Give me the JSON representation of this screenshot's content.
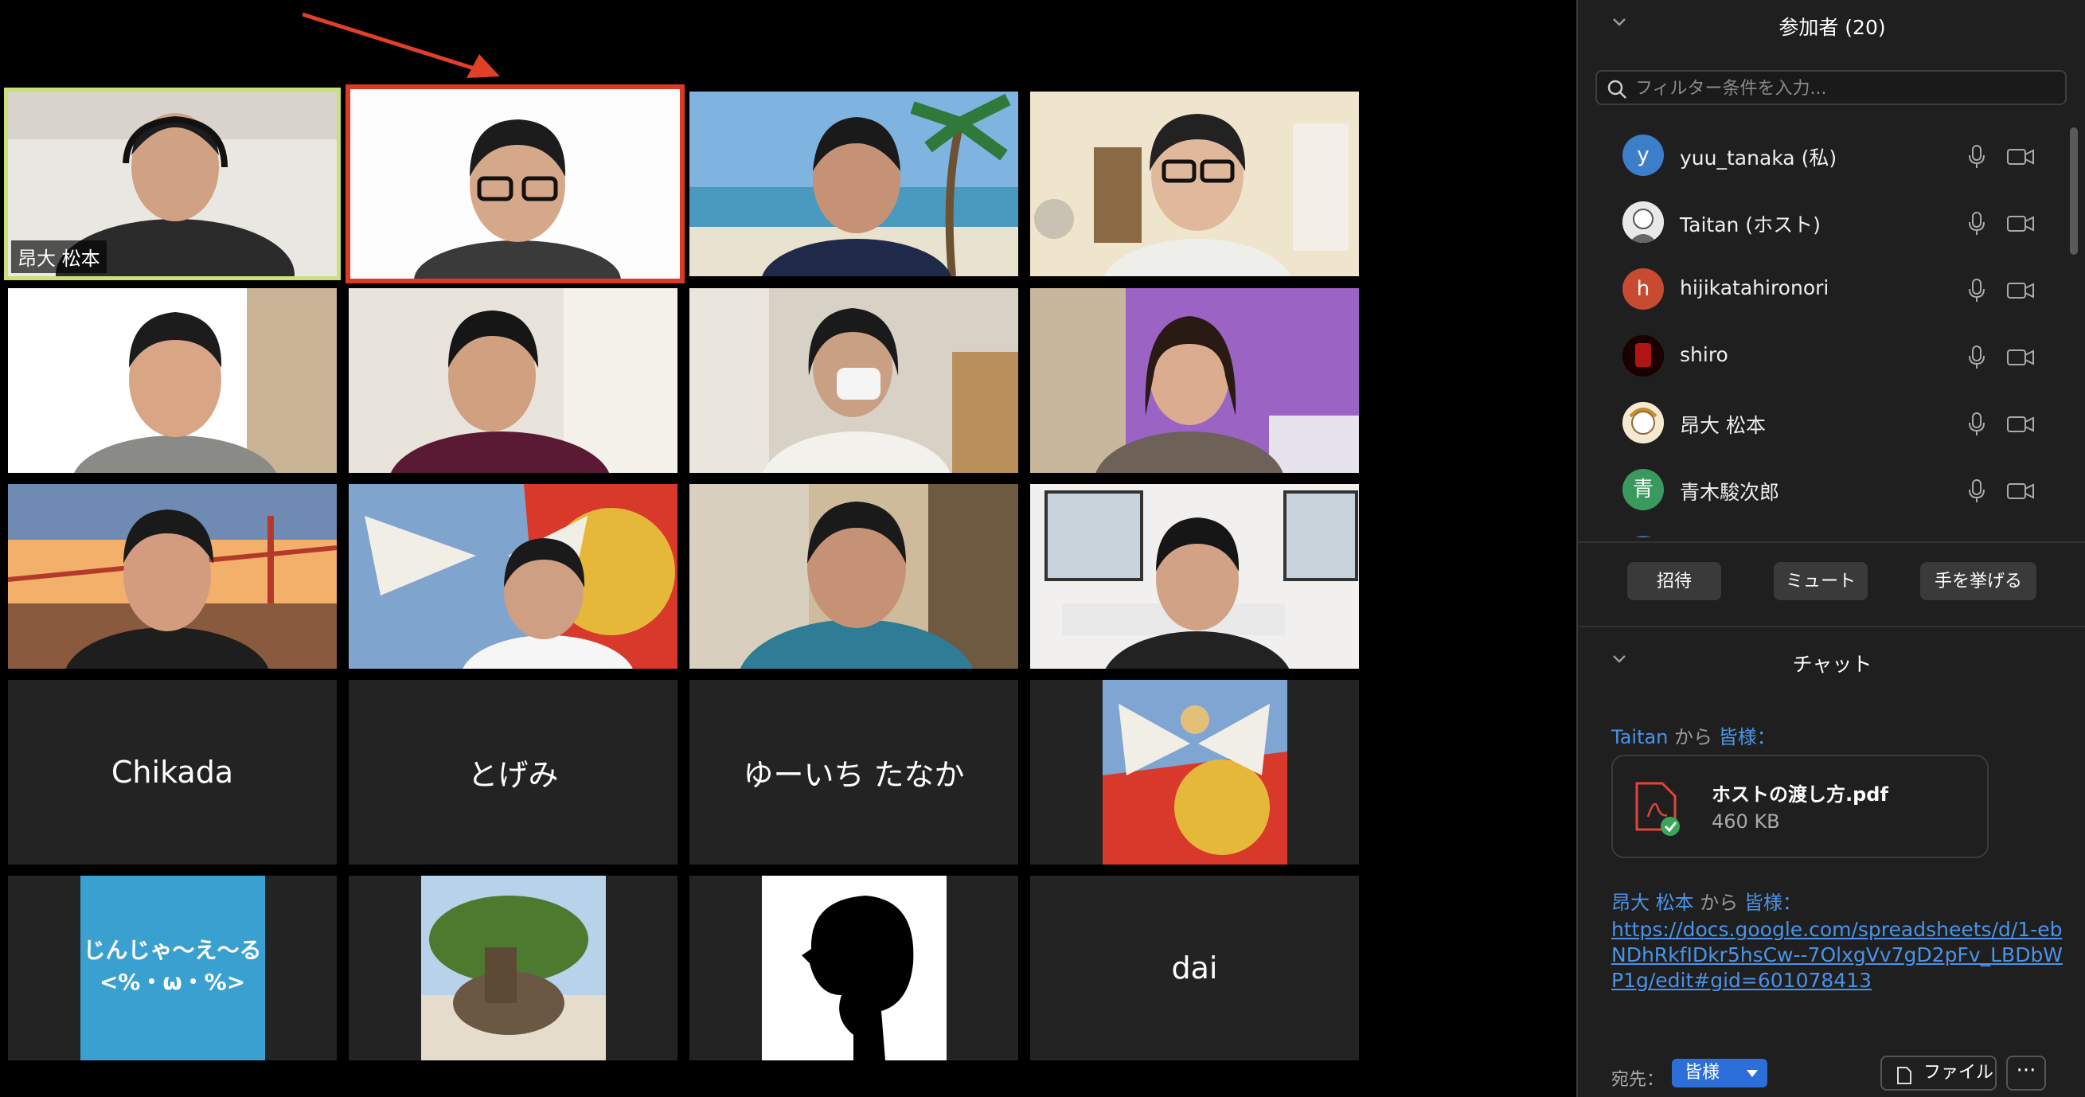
{
  "gallery": {
    "tiles": [
      {
        "id": "t1",
        "label": "昂大 松本"
      },
      {
        "id": "t2",
        "label": ""
      },
      {
        "id": "t3",
        "label": ""
      },
      {
        "id": "t4",
        "label": ""
      },
      {
        "id": "t5",
        "label": ""
      },
      {
        "id": "t6",
        "label": ""
      },
      {
        "id": "t7",
        "label": ""
      },
      {
        "id": "t8",
        "label": ""
      },
      {
        "id": "t9",
        "label": ""
      },
      {
        "id": "t10",
        "label": ""
      },
      {
        "id": "t11",
        "label": ""
      },
      {
        "id": "t12",
        "label": ""
      },
      {
        "id": "t13",
        "label": "Chikada"
      },
      {
        "id": "t14",
        "label": "とげみ"
      },
      {
        "id": "t15",
        "label": "ゆーいち たなか"
      },
      {
        "id": "t16",
        "label": ""
      },
      {
        "id": "t17",
        "label": ""
      },
      {
        "id": "t18",
        "label": ""
      },
      {
        "id": "t19",
        "label": ""
      },
      {
        "id": "t20",
        "label": "dai"
      }
    ],
    "avatar_text_line1": "じんじゃ～え～る",
    "avatar_text_line2": "<%・ω・%>",
    "colors": {
      "active_border": "#d93b24",
      "speaker_border": "#c9e07d",
      "tile_bg": "#232323"
    }
  },
  "participants": {
    "title": "参加者 (20)",
    "filter_placeholder": "フィルター条件を入力...",
    "list": [
      {
        "initial": "y",
        "name": "yuu_tanaka (私)",
        "color": "#3d7ecb"
      },
      {
        "initial": "",
        "name": "Taitan (ホスト)",
        "color": "#cfcfcf"
      },
      {
        "initial": "h",
        "name": "hijikatahironori",
        "color": "#c84a31"
      },
      {
        "initial": "",
        "name": "shiro",
        "color": "#8a1010"
      },
      {
        "initial": "",
        "name": "昂大 松本",
        "color": "#e8d6a0"
      },
      {
        "initial": "青",
        "name": "青木駿次郎",
        "color": "#3a9a5e"
      }
    ],
    "buttons": {
      "invite": "招待",
      "mute": "ミュート",
      "raise_hand": "手を挙げる"
    }
  },
  "chat": {
    "title": "チャット",
    "from_word": "から",
    "messages": [
      {
        "sender": "Taitan",
        "recipient": "皆様：",
        "file_name": "ホストの渡し方.pdf",
        "file_size": "460 KB"
      },
      {
        "sender": "昂大 松本",
        "recipient": "皆様：",
        "link": "https://docs.google.com/spreadsheets/d/1-ebNDhRkfIDkr5hsCw--7OlxgVv7gD2pFv_LBDbWP1g/edit#gid=601078413"
      }
    ],
    "to_label": "宛先：",
    "to_value": "皆様",
    "file_button": "ファイル",
    "more_button": "···"
  }
}
